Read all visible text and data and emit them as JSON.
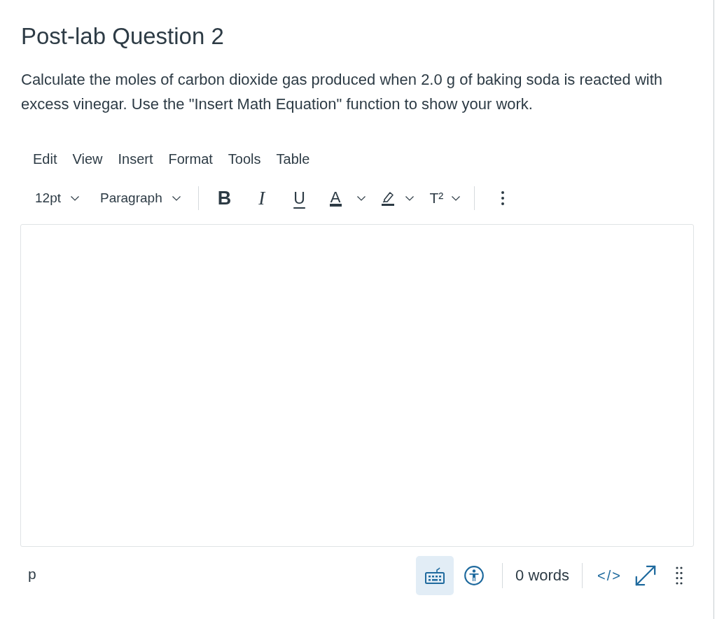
{
  "question": {
    "title": "Post-lab Question 2",
    "prompt": "Calculate the moles of carbon dioxide gas produced when 2.0 g of baking soda is reacted with excess vinegar. Use the \"Insert Math Equation\" function to show your work."
  },
  "menu": [
    "Edit",
    "View",
    "Insert",
    "Format",
    "Tools",
    "Table"
  ],
  "toolbar": {
    "font_size": "12pt",
    "block_format": "Paragraph",
    "bold": "B",
    "italic": "I",
    "underline": "U",
    "text_color": "A",
    "superscript": "T²"
  },
  "status_bar": {
    "path": "p",
    "keyboard_shortcuts": {
      "active": true
    },
    "word_count": "0 words",
    "html_toggle": "</>"
  }
}
